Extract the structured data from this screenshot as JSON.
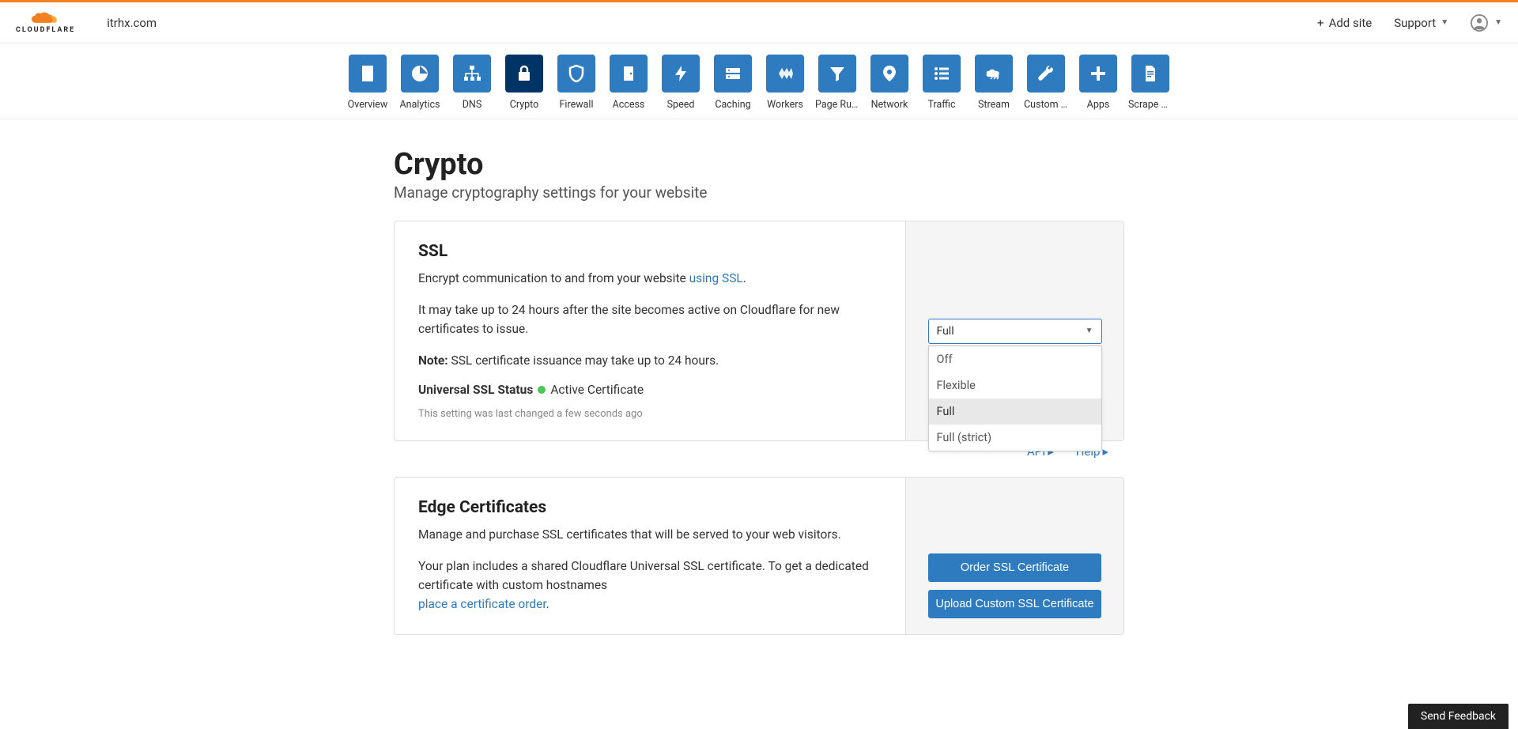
{
  "header": {
    "logo_text": "CLOUDFLARE",
    "domain": "itrhx.com",
    "add_site": "Add site",
    "support": "Support"
  },
  "nav": {
    "items": [
      {
        "label": "Overview"
      },
      {
        "label": "Analytics"
      },
      {
        "label": "DNS"
      },
      {
        "label": "Crypto"
      },
      {
        "label": "Firewall"
      },
      {
        "label": "Access"
      },
      {
        "label": "Speed"
      },
      {
        "label": "Caching"
      },
      {
        "label": "Workers"
      },
      {
        "label": "Page Rules"
      },
      {
        "label": "Network"
      },
      {
        "label": "Traffic"
      },
      {
        "label": "Stream"
      },
      {
        "label": "Custom P..."
      },
      {
        "label": "Apps"
      },
      {
        "label": "Scrape S..."
      }
    ]
  },
  "page": {
    "title": "Crypto",
    "subtitle": "Manage cryptography settings for your website"
  },
  "ssl_card": {
    "title": "SSL",
    "desc_pre": "Encrypt communication to and from your website ",
    "desc_link": "using SSL",
    "desc_post": ".",
    "note_body": "It may take up to 24 hours after the site becomes active on Cloudflare for new certificates to issue.",
    "note_label": "Note:",
    "note_text": " SSL certificate issuance may take up to 24 hours.",
    "status_label": "Universal SSL Status",
    "status_value": "Active Certificate",
    "timestamp": "This setting was last changed a few seconds ago",
    "dropdown": {
      "selected": "Full",
      "options": [
        "Off",
        "Flexible",
        "Full",
        "Full (strict)"
      ]
    },
    "api_link": "API",
    "help_link": "Help"
  },
  "edge_card": {
    "title": "Edge Certificates",
    "desc": "Manage and purchase SSL certificates that will be served to your web visitors.",
    "plan_text": "Your plan includes a shared Cloudflare Universal SSL certificate. To get a dedicated certificate with custom hostnames",
    "plan_link": "place a certificate order",
    "plan_post": ".",
    "btn_order": "Order SSL Certificate",
    "btn_upload": "Upload Custom SSL Certificate"
  },
  "feedback": "Send Feedback"
}
